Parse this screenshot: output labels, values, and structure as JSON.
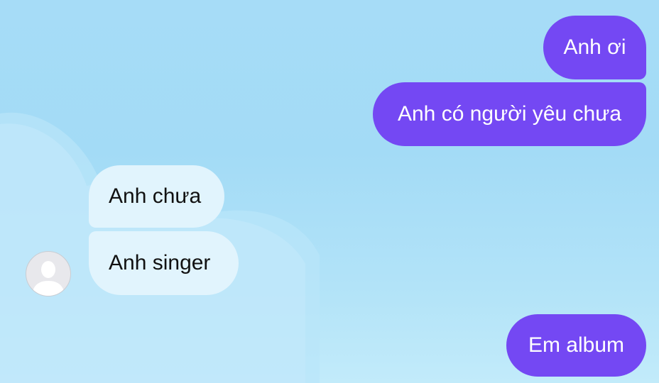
{
  "chat": {
    "messages": [
      {
        "direction": "sent",
        "text": "Anh ơi"
      },
      {
        "direction": "sent",
        "text": "Anh có người yêu chưa"
      },
      {
        "direction": "received",
        "text": "Anh chưa"
      },
      {
        "direction": "received",
        "text": "Anh singer"
      },
      {
        "direction": "sent",
        "text": "Em album"
      }
    ],
    "contact_avatar_icon": "default-user-avatar-icon"
  },
  "colors": {
    "sent_bubble": "#7448f3",
    "received_bubble": "#e1f4fd",
    "background": "#a6dcf7",
    "cloud": "#c6ebfb"
  }
}
